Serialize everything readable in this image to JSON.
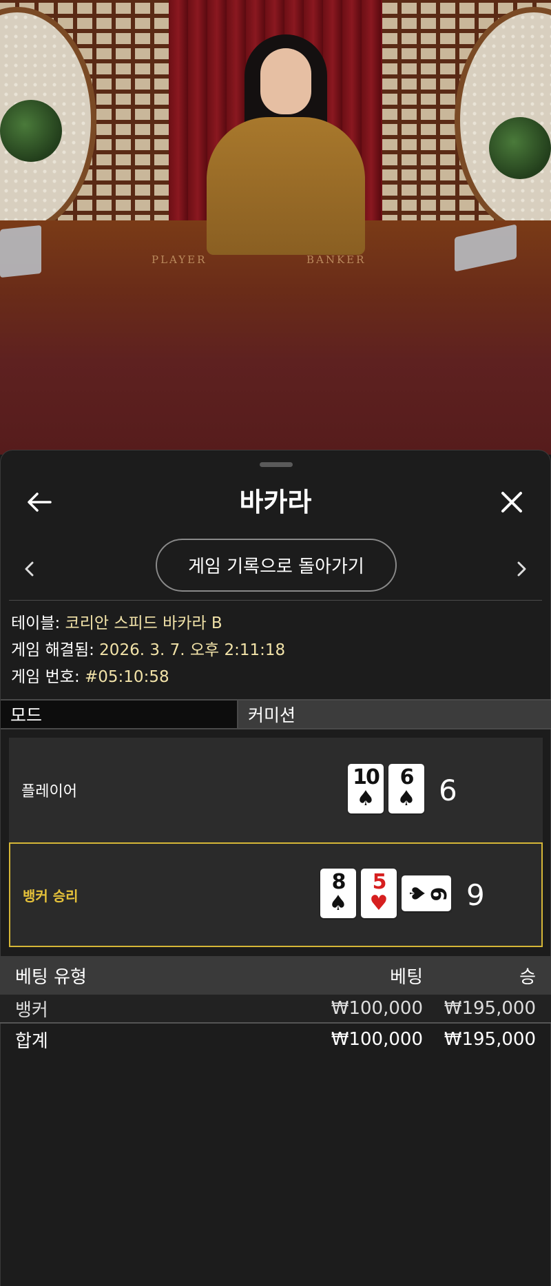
{
  "header": {
    "title": "바카라"
  },
  "nav": {
    "history_button_label": "게임 기록으로 돌아가기"
  },
  "video": {
    "table_player_text": "PLAYER",
    "table_banker_text": "BANKER"
  },
  "info": {
    "table_key": "테이블: ",
    "table_value": "코리안 스피드 바카라 B",
    "resolved_key": "게임 해결됨: ",
    "resolved_value": "2026. 3. 7. 오후 2:11:18",
    "game_no_key": "게임 번호: ",
    "game_no_value": "#05:10:58"
  },
  "mode": {
    "label": "모드",
    "value": "커미션"
  },
  "hands": {
    "player": {
      "label": "플레이어",
      "score": "6",
      "cards": [
        {
          "rank": "10",
          "suit": "♠",
          "color": "#111111"
        },
        {
          "rank": "6",
          "suit": "♠",
          "color": "#111111"
        }
      ]
    },
    "banker": {
      "label": "뱅커 승리",
      "score": "9",
      "cards": [
        {
          "rank": "8",
          "suit": "♠",
          "color": "#111111"
        },
        {
          "rank": "5",
          "suit": "♥",
          "color": "#d61f1f"
        },
        {
          "rank": "6",
          "suit": "♠",
          "color": "#111111",
          "sideways": true
        }
      ]
    }
  },
  "bets": {
    "headers": {
      "type": "베팅 유형",
      "bet": "베팅",
      "win": "승"
    },
    "rows": [
      {
        "type": "뱅커",
        "bet": "₩100,000",
        "win": "₩195,000"
      }
    ],
    "total": {
      "label": "합계",
      "bet": "₩100,000",
      "win": "₩195,000"
    }
  },
  "colors": {
    "accent_gold": "#d6b737",
    "info_value": "#f1e2a8",
    "heart_red": "#d61f1f"
  }
}
